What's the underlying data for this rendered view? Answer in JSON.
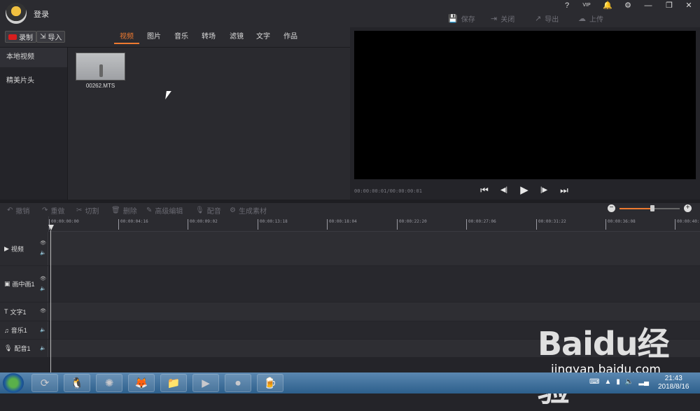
{
  "titlebar": {
    "login_label": "登录",
    "window_buttons": [
      "?",
      "VIP",
      "🔔",
      "⚙",
      "—",
      "❐",
      "✕"
    ],
    "actions": [
      {
        "icon": "save-icon",
        "glyph": "💾",
        "label": "保存"
      },
      {
        "icon": "exit-icon",
        "glyph": "⇥",
        "label": "关闭"
      },
      {
        "icon": "export-icon",
        "glyph": "↗",
        "label": "导出"
      },
      {
        "icon": "upload-icon",
        "glyph": "☁",
        "label": "上传"
      }
    ]
  },
  "library": {
    "record_label": "录制",
    "import_label": "导入",
    "tabs": [
      "视频",
      "图片",
      "音乐",
      "转场",
      "滤镜",
      "文字",
      "作品"
    ],
    "active_tab": "视频",
    "sidebar": [
      "本地视频",
      "精美片头"
    ],
    "media_items": [
      {
        "name": "00262.MTS"
      }
    ]
  },
  "preview": {
    "timecode": "00:00:00:01/00:00:00:01",
    "controls": [
      "⏮",
      "◀|",
      "▶",
      "|▶",
      "⏭"
    ]
  },
  "toolbar": {
    "items": [
      {
        "glyph": "↶",
        "label": "撤销"
      },
      {
        "glyph": "↷",
        "label": "重做"
      },
      {
        "glyph": "✂",
        "label": "切割"
      },
      {
        "glyph": "🗑",
        "label": "删除"
      },
      {
        "glyph": "✎",
        "label": "高级编辑"
      },
      {
        "glyph": "🎙",
        "label": "配音"
      },
      {
        "glyph": "⚙",
        "label": "生成素材"
      }
    ],
    "zoom_level": 0.55
  },
  "ruler": {
    "ticks": [
      "00:00:00:00",
      "00:00:04:16",
      "00:00:09:02",
      "00:00:13:18",
      "00:00:18:04",
      "00:00:22:20",
      "00:00:27:06",
      "00:00:31:22",
      "00:00:36:08",
      "00:00:40:"
    ]
  },
  "tracks": [
    {
      "glyph": "▶",
      "label": "视频",
      "eye": "👁",
      "sound": "🔈"
    },
    {
      "glyph": "▣",
      "label": "画中画1",
      "eye": "👁",
      "sound": "🔈"
    },
    {
      "glyph": "T",
      "label": "文字1",
      "eye": "👁",
      "sound": ""
    },
    {
      "glyph": "♫",
      "label": "音乐1",
      "eye": "",
      "sound": "🔈"
    },
    {
      "glyph": "🎙",
      "label": "配音1",
      "eye": "",
      "sound": "🔈"
    }
  ],
  "taskbar": {
    "apps": [
      "⟳",
      "🐧",
      "✺",
      "🦊",
      "📁",
      "▶",
      "⏺",
      "🍺"
    ],
    "clock_time": "21:43",
    "clock_date": "2018/8/16"
  },
  "watermark": {
    "main": "Baidu经验",
    "url": "jingyan.baidu.com"
  },
  "colors": {
    "accent": "#ee7a30",
    "record": "#d81e1e",
    "background": "#242429"
  }
}
